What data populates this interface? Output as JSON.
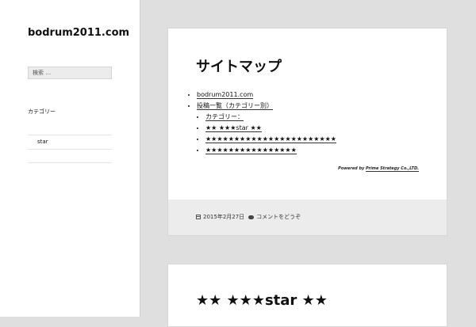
{
  "sidebar": {
    "site_title": "bodrum2011.com",
    "search_placeholder": "検索 …",
    "widget_title": "カテゴリー",
    "widget_items": [
      "star",
      ""
    ]
  },
  "posts": [
    {
      "title": "サイトマップ",
      "links": [
        {
          "label": "bodrum2011.com",
          "children": []
        },
        {
          "label": "投稿一覧（カテゴリー別）",
          "children": [
            "カテゴリー：",
            "★★ ★★★star ★★",
            "★★★★★★★★★★★★★★★★★★★★★★★",
            "★★★★★★★★★★★★★★★★"
          ]
        }
      ],
      "powered_prefix": "Powered by",
      "powered_link": "Prime Strategy Co.,LTD.",
      "date": "2015年2月27日",
      "comments": "コメントをどうぞ"
    },
    {
      "title": "★★ ★★★star ★★"
    }
  ]
}
